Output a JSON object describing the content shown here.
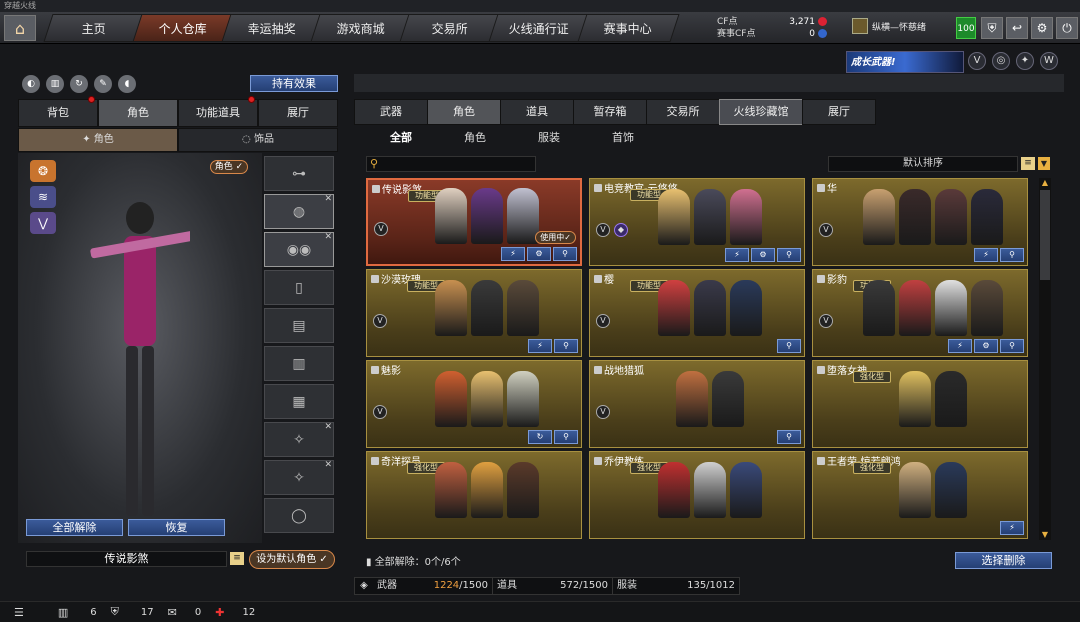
{
  "window": {
    "title": "穿越火线"
  },
  "nav": {
    "items": [
      {
        "label": "主页",
        "active": false
      },
      {
        "label": "个人仓库",
        "active": true
      },
      {
        "label": "幸运抽奖",
        "active": false
      },
      {
        "label": "游戏商城",
        "active": false
      },
      {
        "label": "交易所",
        "active": false
      },
      {
        "label": "火线通行证",
        "active": false
      },
      {
        "label": "赛事中心",
        "active": false
      }
    ]
  },
  "currency": {
    "cf_label": "CF点",
    "cf_value": "3,271",
    "match_cf_label": "赛事CF点",
    "match_cf_value": "0"
  },
  "user": {
    "name": "纵横—怀慈绪",
    "level": "100"
  },
  "banner": {
    "text": "成长武器!"
  },
  "left": {
    "hold_effect_label": "持有效果",
    "tabs": [
      "背包",
      "角色",
      "功能道具",
      "展厅"
    ],
    "active_tab": 1,
    "subtabs": [
      "角色",
      "饰品"
    ],
    "role_tag": "角色 ✓",
    "unequip_all_label": "全部解除",
    "restore_label": "恢复",
    "preset_name": "传说影煞",
    "set_default_label": "设为默认角色 ✓"
  },
  "right": {
    "tabs": [
      "武器",
      "角色",
      "道具",
      "暂存箱",
      "交易所",
      "火线珍藏馆",
      "展厅"
    ],
    "active_tab": 1,
    "subtabs": [
      "全部",
      "角色",
      "服装",
      "首饰"
    ],
    "active_subtab": 0,
    "search_placeholder": "",
    "sort_label": "默认排序",
    "cards": [
      {
        "name": "传说影煞",
        "badge": "功能型",
        "in_use": "使用中✓",
        "selected": true
      },
      {
        "name": "电竞教官-云悠悠",
        "badge": "功能型",
        "in_use": "",
        "selected": false
      },
      {
        "name": "华",
        "badge": "",
        "in_use": "",
        "selected": false
      },
      {
        "name": "沙漠玫瑰",
        "badge": "功能型",
        "in_use": "",
        "selected": false
      },
      {
        "name": "樱",
        "badge": "功能型",
        "in_use": "",
        "selected": false
      },
      {
        "name": "影豹",
        "badge": "功能型",
        "in_use": "",
        "selected": false
      },
      {
        "name": "魅影",
        "badge": "",
        "in_use": "",
        "selected": false
      },
      {
        "name": "战地猎狐",
        "badge": "",
        "in_use": "",
        "selected": false
      },
      {
        "name": "堕落女神",
        "badge": "强化型",
        "in_use": "",
        "selected": false
      },
      {
        "name": "奇洋探员",
        "badge": "强化型",
        "in_use": "",
        "selected": false
      },
      {
        "name": "乔伊教练",
        "badge": "强化型",
        "in_use": "",
        "selected": false
      },
      {
        "name": "王者荣-惊若翩鸿",
        "badge": "强化型",
        "in_use": "",
        "selected": false
      }
    ],
    "clear_all_label": "全部解除：0个/6个",
    "batch_delete_label": "选择删除",
    "capacity": {
      "weapon_label": "武器",
      "weapon_used": "1224",
      "weapon_total": "/1500",
      "item_label": "道具",
      "item_value": "572/1500",
      "outfit_label": "服装",
      "outfit_value": "135/1012"
    }
  },
  "bottom": {
    "mail_count": "6",
    "shield_count": "17",
    "chat_count": "0",
    "gift_count": "12"
  }
}
